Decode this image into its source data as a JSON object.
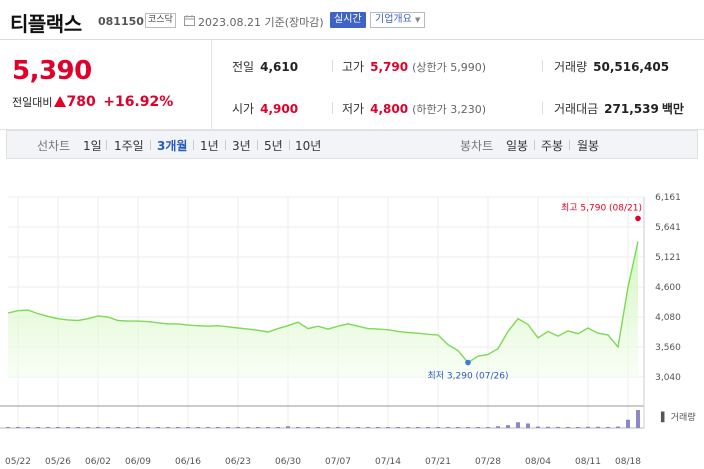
{
  "header": {
    "name": "티플랙스",
    "code": "081150",
    "market": "코스닥",
    "date_label": "2023.08.21 기준(장마감)",
    "realtime_label": "실시간",
    "company_label": "기업개요"
  },
  "summary": {
    "price": "5,390",
    "change_label": "전일대비",
    "change_amount": "780",
    "change_percent": "+16.92%",
    "prev_close_label": "전일",
    "prev_close": "4,610",
    "high_label": "고가",
    "high": "5,790",
    "upper_limit": "(상한가 5,990)",
    "volume_label": "거래량",
    "volume": "50,516,405",
    "open_label": "시가",
    "open": "4,900",
    "low_label": "저가",
    "low": "4,800",
    "lower_limit": "(하한가 3,230)",
    "amount_label": "거래대금",
    "amount": "271,539",
    "amount_unit": "백만"
  },
  "tabs": {
    "line_chart": "선차트",
    "periods": [
      "1일",
      "1주일",
      "3개월",
      "1년",
      "3년",
      "5년",
      "10년"
    ],
    "selected_period": "3개월",
    "candle_chart": "봉차트",
    "candle_periods": [
      "일봉",
      "주봉",
      "월봉"
    ]
  },
  "colors": {
    "accent_red": "#e0002a",
    "accent_blue": "#2a5bbd",
    "line_green": "#7dd957",
    "volume_purple": "#8d86c9"
  },
  "chart_data": {
    "type": "area",
    "y_ticks": [
      "6,161",
      "5,641",
      "5,121",
      "4,600",
      "4,080",
      "3,560",
      "3,040"
    ],
    "ylim": [
      3040,
      6161
    ],
    "x_ticks": [
      "05/22",
      "05/26",
      "06/02",
      "06/09",
      "06/16",
      "06/23",
      "06/30",
      "07/07",
      "07/14",
      "07/21",
      "07/28",
      "08/04",
      "08/11",
      "08/18"
    ],
    "x": [
      "05/19",
      "05/22",
      "05/23",
      "05/24",
      "05/25",
      "05/26",
      "05/30",
      "05/31",
      "06/01",
      "06/02",
      "06/05",
      "06/07",
      "06/08",
      "06/09",
      "06/12",
      "06/13",
      "06/14",
      "06/15",
      "06/16",
      "06/19",
      "06/20",
      "06/21",
      "06/22",
      "06/23",
      "06/26",
      "06/27",
      "06/28",
      "06/29",
      "06/30",
      "07/03",
      "07/04",
      "07/05",
      "07/06",
      "07/07",
      "07/10",
      "07/11",
      "07/12",
      "07/13",
      "07/14",
      "07/17",
      "07/18",
      "07/19",
      "07/20",
      "07/21",
      "07/24",
      "07/25",
      "07/26",
      "07/27",
      "07/28",
      "07/31",
      "08/01",
      "08/02",
      "08/03",
      "08/04",
      "08/07",
      "08/08",
      "08/09",
      "08/10",
      "08/11",
      "08/14",
      "08/16",
      "08/17",
      "08/18",
      "08/21"
    ],
    "values": [
      4150,
      4190,
      4200,
      4140,
      4090,
      4050,
      4030,
      4020,
      4050,
      4100,
      4080,
      4020,
      4010,
      4010,
      4000,
      3980,
      3960,
      3960,
      3940,
      3930,
      3920,
      3930,
      3910,
      3890,
      3870,
      3850,
      3820,
      3880,
      3930,
      3990,
      3880,
      3920,
      3870,
      3920,
      3960,
      3920,
      3880,
      3870,
      3860,
      3830,
      3810,
      3800,
      3780,
      3770,
      3600,
      3500,
      3290,
      3400,
      3430,
      3530,
      3830,
      4050,
      3950,
      3720,
      3830,
      3750,
      3840,
      3790,
      3890,
      3800,
      3770,
      3560,
      4600,
      5390
    ],
    "volume_label": "거래량",
    "volume": [
      0.02,
      0.02,
      0.01,
      0.01,
      0.01,
      0.01,
      0.01,
      0.01,
      0.01,
      0.01,
      0.01,
      0.01,
      0.01,
      0.01,
      0.01,
      0.01,
      0.01,
      0.01,
      0.01,
      0.01,
      0.01,
      0.01,
      0.01,
      0.01,
      0.01,
      0.01,
      0.01,
      0.01,
      0.1,
      0.03,
      0.01,
      0.01,
      0.01,
      0.02,
      0.01,
      0.01,
      0.01,
      0.01,
      0.01,
      0.01,
      0.01,
      0.01,
      0.01,
      0.01,
      0.01,
      0.01,
      0.01,
      0.01,
      0.04,
      0.1,
      0.16,
      0.32,
      0.25,
      0.08,
      0.07,
      0.06,
      0.06,
      0.03,
      0.07,
      0.07,
      0.06,
      0.08,
      0.46,
      1.0
    ],
    "annotations": {
      "high": {
        "label": "최고",
        "value": "5,790",
        "date": "(08/21)"
      },
      "low": {
        "label": "최저",
        "value": "3,290",
        "date": "(07/26)"
      }
    }
  }
}
